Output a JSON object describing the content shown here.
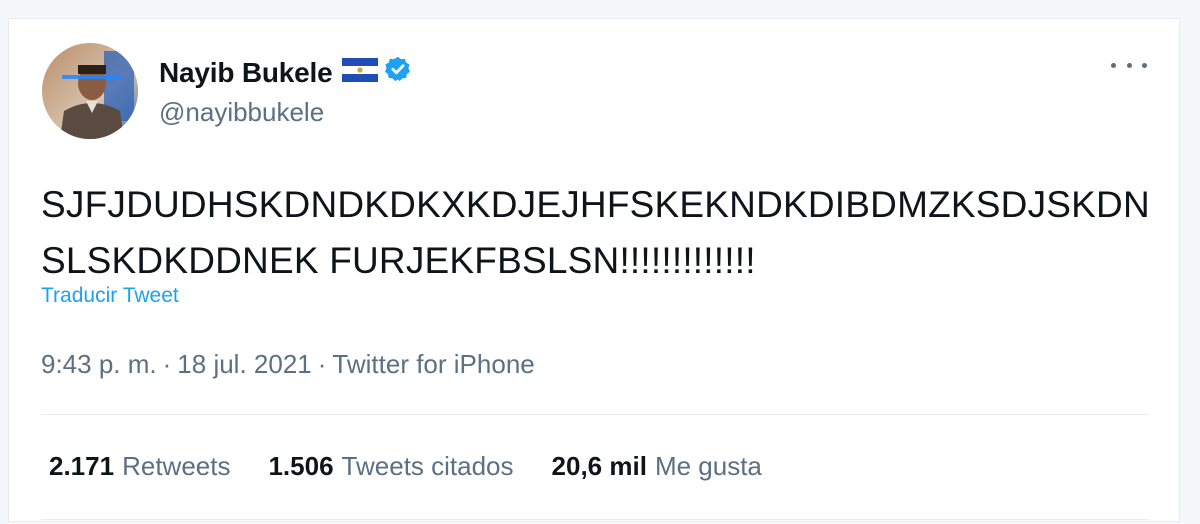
{
  "user": {
    "name": "Nayib Bukele",
    "handle": "@nayibbukele",
    "flag_icon": "el-salvador-flag-icon",
    "verified_icon": "verified-badge-icon"
  },
  "tweet": {
    "text": "SJFJDUDHSKDNDKDKXKDJEJHFSKEKNDKDIBDMZKSDJSKDNSLSKDKDDNEK FURJEKFBSLSN!!!!!!!!!!!!!",
    "translate_label": "Traducir Tweet",
    "time": "9:43 p. m.",
    "date": "18 jul. 2021",
    "source": "Twitter for iPhone",
    "separator": "·"
  },
  "stats": [
    {
      "value": "2.171",
      "label": "Retweets"
    },
    {
      "value": "1.506",
      "label": "Tweets citados"
    },
    {
      "value": "20,6 mil",
      "label": "Me gusta"
    }
  ],
  "colors": {
    "link": "#1da1f2",
    "secondary_text": "#5b7083",
    "primary_text": "#0f1419",
    "verified": "#1da1f2"
  }
}
